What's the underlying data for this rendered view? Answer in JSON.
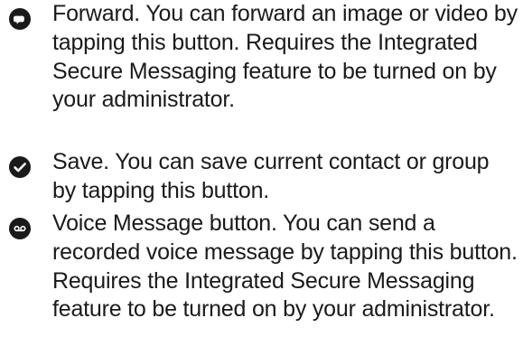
{
  "items": [
    {
      "icon": "forward-icon",
      "text": "Forward. You can forward an image or video by tapping this button. Requires the Integrated Secure Messaging feature to be turned on by your administrator."
    },
    {
      "icon": "checkmark-icon",
      "text": "Save. You can save current contact or group by tapping this button."
    },
    {
      "icon": "voicemail-icon",
      "text": "Voice Message button. You can send a recorded voice message by tapping this button. Requires the Integrated Secure Messaging feature to be turned on by your administrator."
    }
  ],
  "colors": {
    "text": "#1a1a1a",
    "icon": "#1a1a1a",
    "background": "#ffffff"
  }
}
